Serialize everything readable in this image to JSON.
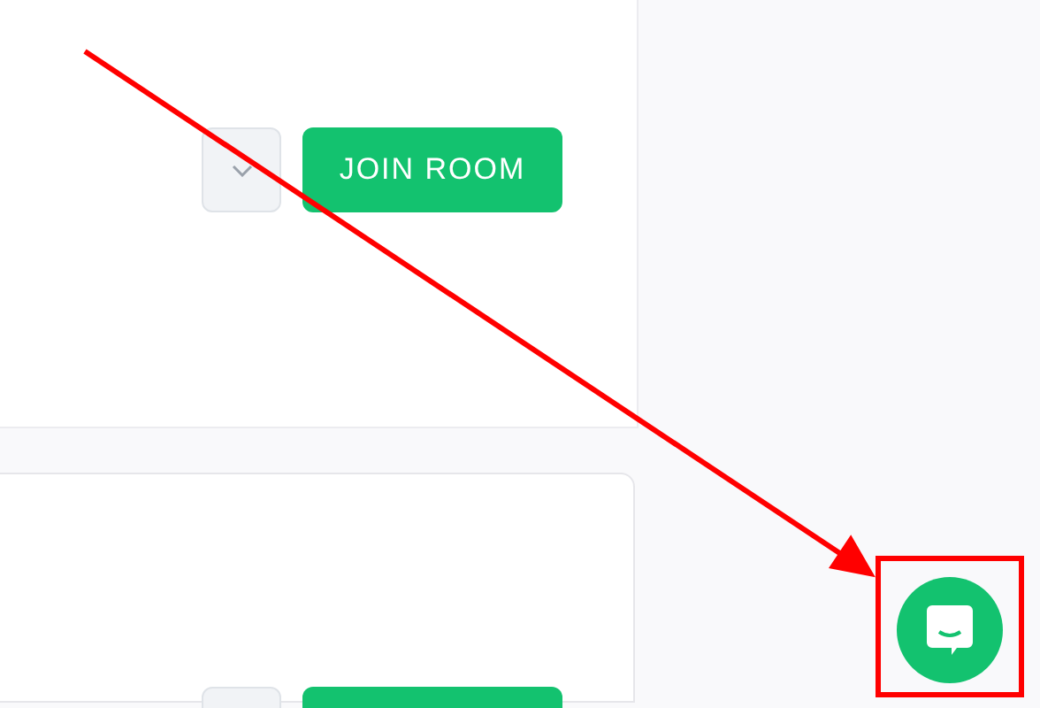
{
  "rooms": [
    {
      "kind": "divided",
      "join_label": "JOIN ROOM"
    },
    {
      "kind": "rounded"
    }
  ]
}
